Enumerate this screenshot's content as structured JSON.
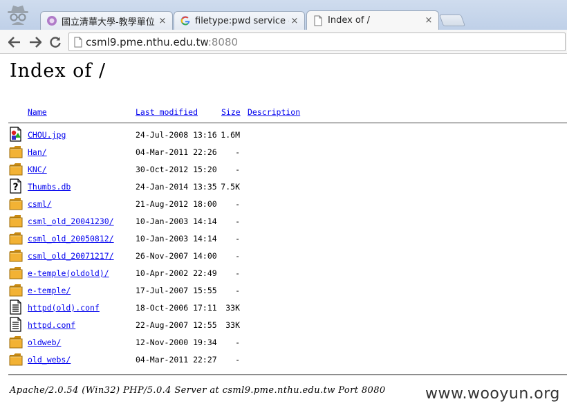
{
  "browser": {
    "tabs": [
      {
        "title": "國立清華大學-教學單位",
        "close": "×"
      },
      {
        "title": "filetype:pwd service - Gi",
        "close": "×"
      },
      {
        "title": "Index of /",
        "close": "×"
      }
    ],
    "address": {
      "host": "csml9.pme.nthu.edu.tw",
      "port": ":8080"
    }
  },
  "page": {
    "heading": "Index of /",
    "columns": {
      "name": "Name",
      "modified": "Last modified",
      "size": "Size",
      "description": "Description"
    },
    "entries": [
      {
        "name": "CHOU.jpg",
        "modified": "24-Jul-2008 13:16",
        "size": "1.6M",
        "icon": "image-file-icon"
      },
      {
        "name": "Han/",
        "modified": "04-Mar-2011 22:26",
        "size": "-",
        "icon": "folder-icon"
      },
      {
        "name": "KNC/",
        "modified": "30-Oct-2012 15:20",
        "size": "-",
        "icon": "folder-icon"
      },
      {
        "name": "Thumbs.db",
        "modified": "24-Jan-2014 13:35",
        "size": "7.5K",
        "icon": "unknown-file-icon"
      },
      {
        "name": "csml/",
        "modified": "21-Aug-2012 18:00",
        "size": "-",
        "icon": "folder-icon"
      },
      {
        "name": "csml_old_20041230/",
        "modified": "10-Jan-2003 14:14",
        "size": "-",
        "icon": "folder-icon"
      },
      {
        "name": "csml_old_20050812/",
        "modified": "10-Jan-2003 14:14",
        "size": "-",
        "icon": "folder-icon"
      },
      {
        "name": "csml_old_20071217/",
        "modified": "26-Nov-2007 14:00",
        "size": "-",
        "icon": "folder-icon"
      },
      {
        "name": "e-temple(oldold)/",
        "modified": "10-Apr-2002 22:49",
        "size": "-",
        "icon": "folder-icon"
      },
      {
        "name": "e-temple/",
        "modified": "17-Jul-2007 15:55",
        "size": "-",
        "icon": "folder-icon"
      },
      {
        "name": "httpd(old).conf",
        "modified": "18-Oct-2006 17:11",
        "size": "33K",
        "icon": "text-file-icon"
      },
      {
        "name": "httpd.conf",
        "modified": "22-Aug-2007 12:55",
        "size": "33K",
        "icon": "text-file-icon"
      },
      {
        "name": "oldweb/",
        "modified": "12-Nov-2000 19:34",
        "size": "-",
        "icon": "folder-icon"
      },
      {
        "name": "old_webs/",
        "modified": "04-Mar-2011 22:27",
        "size": "-",
        "icon": "folder-icon"
      }
    ],
    "footer": "Apache/2.0.54 (Win32) PHP/5.0.4 Server at csml9.pme.nthu.edu.tw Port 8080"
  },
  "watermark": "www.wooyun.org",
  "colors": {
    "link": "#0000ee",
    "tabstrip": "#c6d6ec"
  }
}
